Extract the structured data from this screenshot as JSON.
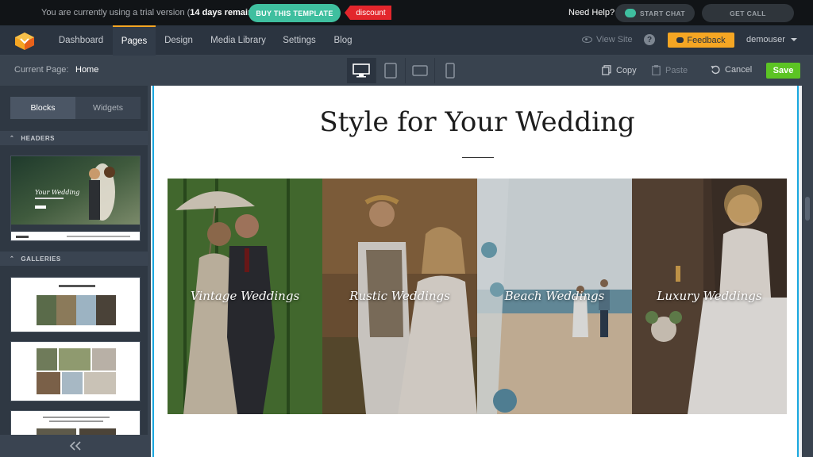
{
  "trial": {
    "prefix": "You are currently using a trial version (",
    "days": "14 days remaining",
    "suffix": ").",
    "buy_label": "BUY THIS TEMPLATE",
    "discount_label": "discount",
    "need_help": "Need Help?",
    "chat_label": "START CHAT",
    "call_label": "GET CALL"
  },
  "nav": {
    "items": [
      "Dashboard",
      "Pages",
      "Design",
      "Media Library",
      "Settings",
      "Blog"
    ],
    "active": "Pages",
    "view_site": "View Site",
    "help": "?",
    "feedback": "Feedback",
    "user": "demouser"
  },
  "toolbar": {
    "current_label": "Current Page:",
    "current_value": "Home",
    "copy": "Copy",
    "paste": "Paste",
    "cancel": "Cancel",
    "save": "Save"
  },
  "sidebar": {
    "tabs": [
      "Blocks",
      "Widgets"
    ],
    "active_tab": "Blocks",
    "sections": [
      "HEADERS",
      "GALLERIES"
    ]
  },
  "canvas": {
    "title": "Style for Your Wedding",
    "gallery": [
      "Vintage Weddings",
      "Rustic Weddings",
      "Beach Weddings",
      "Luxury Weddings"
    ]
  },
  "colors": {
    "accent_orange": "#f5a623",
    "teal": "#3fbf9f",
    "save_green": "#5cc424",
    "discount_red": "#e3262c",
    "canvas_border": "#1aa8e0"
  }
}
